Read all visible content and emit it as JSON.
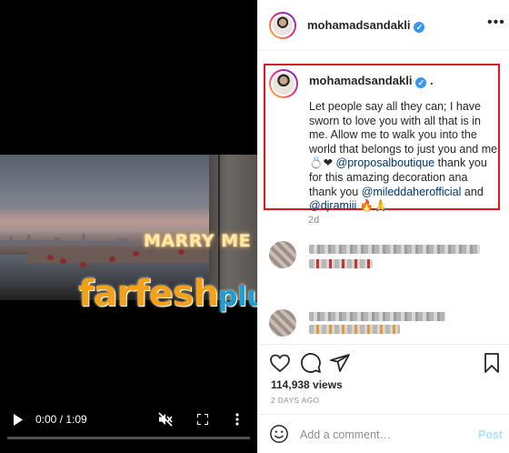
{
  "video": {
    "sign_text": "MARRY ME",
    "time_display": "0:00 / 1:09",
    "progress_fraction": 0,
    "icons": [
      "play-icon",
      "mute-icon",
      "fullscreen-icon",
      "more-vert-icon"
    ]
  },
  "watermark": {
    "part1": "farfesh",
    "part2": "plus.com"
  },
  "header": {
    "username": "mohamadsandakli",
    "verified": true
  },
  "caption": {
    "username": "mohamadsandakli",
    "after_name": ".",
    "line1": "Let people say all they can; I have sworn to love you with all that is in me. Allow me to walk you into the world that belongs to just you and me 💍❤",
    "mention1": "@proposalboutique",
    "line2": " thank you for this amazing decoration ana thank you ",
    "mention2": "@mileddaherofficial",
    "line3": " and ",
    "mention3": "@djramiii",
    "line4": " 🔥🙏",
    "time_ago": "2d"
  },
  "stats": {
    "views": "114,938 views",
    "date": "2 DAYS AGO"
  },
  "comment": {
    "placeholder": "Add a comment…",
    "post_label": "Post"
  },
  "colors": {
    "highlight_box": "#e1191f",
    "mention": "#00376b",
    "verified": "#3897f0",
    "watermark_orange": "#f4a11a",
    "watermark_blue": "#1d9fd6"
  }
}
